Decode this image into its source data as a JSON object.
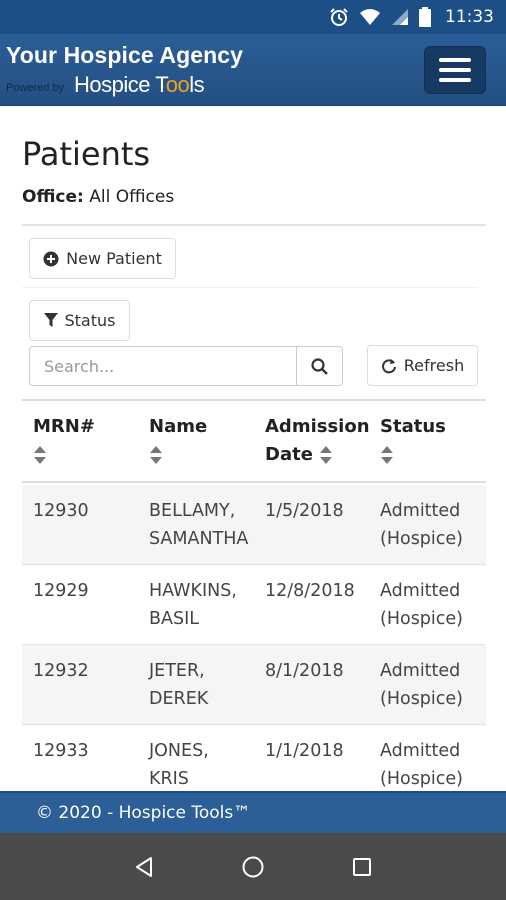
{
  "status_bar": {
    "time": "11:33"
  },
  "header": {
    "title": "Your Hospice Agency",
    "powered_by": "Powered by",
    "logo_prefix": "Hospice T",
    "logo_gear": "oo",
    "logo_suffix": "ls"
  },
  "page": {
    "title": "Patients",
    "office_label": "Office:",
    "office_value": "All Offices"
  },
  "toolbar": {
    "new_patient": "New Patient",
    "status": "Status",
    "search_placeholder": "Search...",
    "refresh": "Refresh"
  },
  "table": {
    "headers": [
      {
        "line1": "MRN#",
        "line2": ""
      },
      {
        "line1": "Name",
        "line2": ""
      },
      {
        "line1": "Admission",
        "line2": "Date"
      },
      {
        "line1": "Status",
        "line2": ""
      }
    ],
    "rows": [
      {
        "mrn": "12930",
        "name_last": "BELLAMY,",
        "name_first": "SAMANTHA",
        "date": "1/5/2018",
        "status1": "Admitted",
        "status2": "(Hospice)"
      },
      {
        "mrn": "12929",
        "name_last": "HAWKINS,",
        "name_first": "BASIL",
        "date": "12/8/2018",
        "status1": "Admitted",
        "status2": "(Hospice)"
      },
      {
        "mrn": "12932",
        "name_last": "JETER,",
        "name_first": "DEREK",
        "date": "8/1/2018",
        "status1": "Admitted",
        "status2": "(Hospice)"
      },
      {
        "mrn": "12933",
        "name_last": "JONES,",
        "name_first": "KRIS",
        "date": "1/1/2018",
        "status1": "Admitted",
        "status2": "(Hospice)"
      }
    ]
  },
  "footer": {
    "text": "© 2020 - Hospice Tools™"
  },
  "colors": {
    "header_bg": "#2b5e98",
    "menu_btn_bg": "#173a63",
    "footer_bg": "#2c5f97",
    "nav_bg": "#4a4a4a",
    "accent_gear": "#f0a21a"
  }
}
